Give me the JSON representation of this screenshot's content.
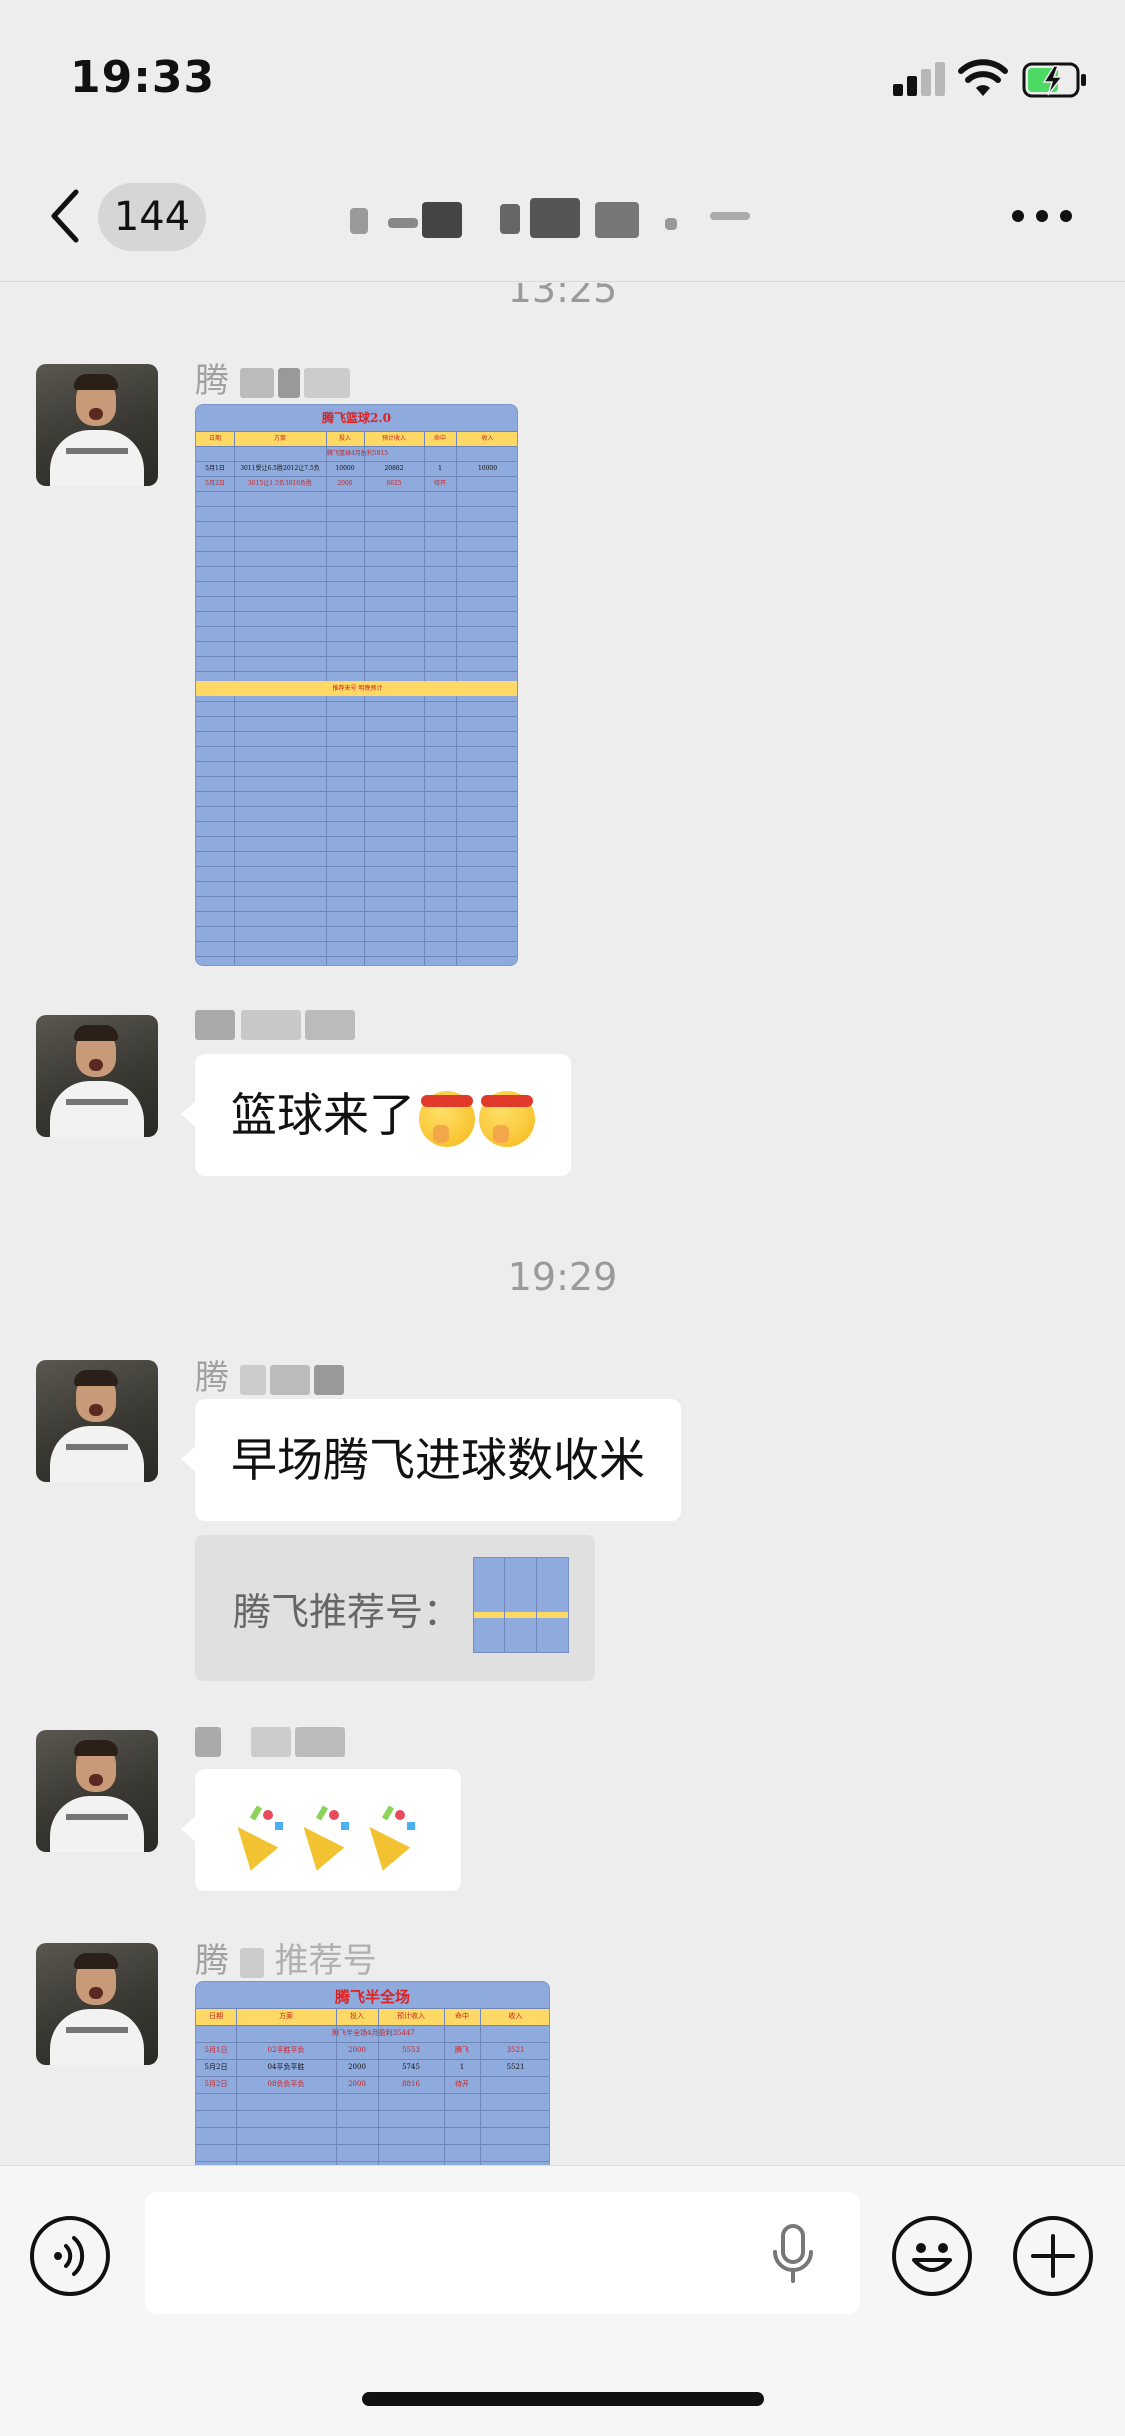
{
  "status_bar": {
    "time": "19:33"
  },
  "nav": {
    "unread_count": "144"
  },
  "timestamps": {
    "first": "13:25",
    "second": "19:29"
  },
  "messages": {
    "m1": {
      "sender_visible": "腾"
    },
    "m2": {
      "sender_visible": "",
      "text": "篮球来了"
    },
    "m3": {
      "sender_visible": "腾",
      "text": "早场腾飞进球数收米"
    },
    "m3_quote": {
      "text": "腾飞推荐号："
    },
    "m4": {
      "sender_visible": ""
    },
    "m5": {
      "sender_visible": "腾",
      "sender_tail": "推荐号"
    }
  },
  "sheet1": {
    "title": "腾飞篮球2.0",
    "headers": [
      "日期",
      "方案",
      "投入",
      "预计收入",
      "命中",
      "收入"
    ],
    "subtitle": "腾飞篮球4月盈利5815",
    "rows": [
      [
        "5月1日",
        "3011受让6.5胜2012让7.5负",
        "10000",
        "20882",
        "1",
        "10000"
      ],
      [
        "5月2日",
        "3015让1.5负3016负胜",
        "2000",
        "6625",
        "待开",
        ""
      ]
    ],
    "footer": "推荐来号   明晚预计"
  },
  "sheet2": {
    "title": "腾飞半全场",
    "headers": [
      "日期",
      "方案",
      "投入",
      "预计收入",
      "命中",
      "收入"
    ],
    "subtitle": "腾飞半全场4月盈利35447",
    "rows": [
      [
        "5月1日",
        "02平胜平负",
        "2000",
        "5553",
        "腾飞",
        "3521"
      ],
      [
        "5月2日",
        "04平负平胜",
        "2000",
        "5745",
        "1",
        "5521"
      ],
      [
        "5月2日",
        "08负负平负",
        "2000",
        "8816",
        "待开",
        ""
      ]
    ]
  },
  "input": {
    "placeholder": ""
  },
  "icons": {
    "back": "chevron-left-icon",
    "more": "more-dots-icon",
    "voice": "voice-icon",
    "mic": "microphone-icon",
    "emoji": "smiley-icon",
    "plus": "plus-icon"
  },
  "colors": {
    "background": "#ededed",
    "bubble": "#ffffff",
    "sheet_blue": "#8faadc",
    "sheet_yellow": "#ffd966",
    "sheet_red": "#dd2222"
  }
}
